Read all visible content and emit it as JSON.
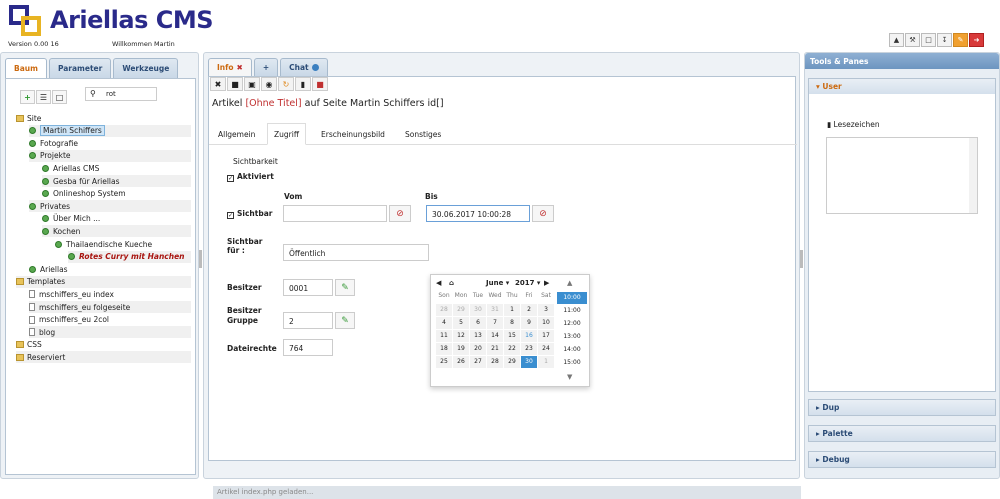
{
  "header": {
    "logo_text": "Ariellas",
    "logo_cms": "CMS",
    "version": "Version 0.00 16",
    "welcome": "Willkommen Martin",
    "buttons": [
      "bell-icon",
      "wrench-icon",
      "folder-icon",
      "download-icon",
      "edit-icon",
      "logout-icon"
    ]
  },
  "left": {
    "tabs": [
      "Baum",
      "Parameter",
      "Werkzeuge"
    ],
    "search_value": "rot",
    "tree": [
      {
        "label": "Site",
        "type": "folder"
      },
      {
        "label": "Martin Schiffers",
        "type": "page",
        "selected": true
      },
      {
        "label": "Fotografie",
        "type": "page"
      },
      {
        "label": "Projekte",
        "type": "page"
      },
      {
        "label": "Ariellas CMS",
        "type": "page"
      },
      {
        "label": "Gesba für Ariellas",
        "type": "page"
      },
      {
        "label": "Onlineshop System",
        "type": "page"
      },
      {
        "label": "Privates",
        "type": "page"
      },
      {
        "label": "Über Mich ...",
        "type": "page"
      },
      {
        "label": "Kochen",
        "type": "page"
      },
      {
        "label": "Thailaendische Kueche",
        "type": "page"
      },
      {
        "label": "Rotes Curry mit Hanchen",
        "type": "page",
        "highlight": true
      },
      {
        "label": "Ariellas",
        "type": "page"
      },
      {
        "label": "Templates",
        "type": "folder"
      },
      {
        "label": "mschiffers_eu index",
        "type": "doc"
      },
      {
        "label": "mschiffers_eu folgeseite",
        "type": "doc"
      },
      {
        "label": "mschiffers_eu 2col",
        "type": "doc"
      },
      {
        "label": "blog",
        "type": "doc"
      },
      {
        "label": "CSS",
        "type": "folder"
      },
      {
        "label": "Reserviert",
        "type": "folder"
      }
    ]
  },
  "mid": {
    "tabs": [
      {
        "label": "Info",
        "icon": "close-icon"
      },
      {
        "label": "+"
      },
      {
        "label": "Chat",
        "icon": "status-dot-icon"
      }
    ],
    "title_prefix": "Artikel",
    "title_red": "[Ohne Titel]",
    "title_suffix": "auf Seite Martin Schiffers id[]",
    "subtabs": [
      "Allgemein",
      "Zugriff",
      "Erscheinungsbild",
      "Sonstiges"
    ],
    "active_subtab": "Zugriff",
    "sichtbarkeit_label": "Sichtbarkeit",
    "aktiviert_label": "Aktiviert",
    "vom_label": "Vom",
    "bis_label": "Bis",
    "sichtbar_label": "Sichtbar",
    "vom_value": "",
    "bis_value": "30.06.2017 10:00:28",
    "sichtbar_fuer_label": "Sichtbar für :",
    "sichtbar_fuer_value": "Öffentlich",
    "besitzer_label": "Besitzer",
    "besitzer_value": "0001",
    "gruppe_label": "Besitzer Gruppe",
    "gruppe_value": "2",
    "rechte_label": "Dateirechte",
    "rechte_value": "764",
    "status": "Artikel index.php geladen..."
  },
  "calendar": {
    "month": "June",
    "year": "2017",
    "weekdays": [
      "Son",
      "Mon",
      "Tue",
      "Wed",
      "Thu",
      "Fri",
      "Sat"
    ],
    "days": [
      [
        "28",
        "29",
        "30",
        "31",
        "1",
        "2",
        "3"
      ],
      [
        "4",
        "5",
        "6",
        "7",
        "8",
        "9",
        "10"
      ],
      [
        "11",
        "12",
        "13",
        "14",
        "15",
        "16",
        "17"
      ],
      [
        "18",
        "19",
        "20",
        "21",
        "22",
        "23",
        "24"
      ],
      [
        "25",
        "26",
        "27",
        "28",
        "29",
        "30",
        "1"
      ]
    ],
    "selected_day": "30",
    "today": "16",
    "times": [
      "10:00",
      "11:00",
      "12:00",
      "13:00",
      "14:00",
      "15:00"
    ],
    "selected_time": "10:00"
  },
  "right": {
    "header": "Tools & Panes",
    "sections": [
      "User",
      "Dup",
      "Palette",
      "Debug"
    ],
    "bookmark_label": "Lesezeichen"
  }
}
